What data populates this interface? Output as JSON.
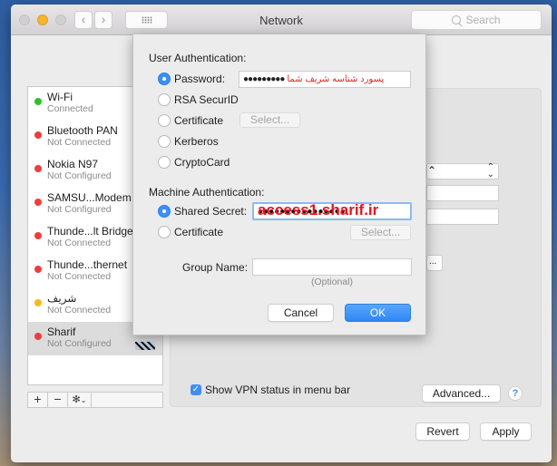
{
  "window": {
    "title": "Network",
    "search_placeholder": "Search",
    "nav_back": "‹",
    "nav_forward": "›"
  },
  "services": [
    {
      "name": "Wi-Fi",
      "status": "Connected",
      "color": "#2ec02e"
    },
    {
      "name": "Bluetooth PAN",
      "status": "Not Connected",
      "color": "#ef3d3d"
    },
    {
      "name": "Nokia N97",
      "status": "Not Configured",
      "color": "#ef3d3d"
    },
    {
      "name": "SAMSU...Modem",
      "status": "Not Configured",
      "color": "#ef3d3d"
    },
    {
      "name": "Thunde...lt Bridge",
      "status": "Not Connected",
      "color": "#ef3d3d"
    },
    {
      "name": "Thunde...thernet",
      "status": "Not Connected",
      "color": "#ef3d3d"
    },
    {
      "name": "شریف",
      "status": "Not Connected",
      "color": "#f6b82a"
    },
    {
      "name": "Sharif",
      "status": "Not Configured",
      "color": "#ef3d3d",
      "selected": true
    }
  ],
  "list_toolbar": {
    "add": "+",
    "remove": "−",
    "gear": "✻",
    "gear_caret": "⌄"
  },
  "panel": {
    "show_vpn_status_label": "Show VPN status in menu bar",
    "show_vpn_status_checked": true,
    "advanced_label": "Advanced...",
    "help_label": "?",
    "partial_button_label": "..."
  },
  "footer": {
    "revert_label": "Revert",
    "apply_label": "Apply"
  },
  "sheet": {
    "user_auth_label": "User Authentication:",
    "user_auth_options": [
      {
        "label": "Password:",
        "selected": true
      },
      {
        "label": "RSA SecurID",
        "selected": false
      },
      {
        "label": "Certificate",
        "selected": false
      },
      {
        "label": "Kerberos",
        "selected": false
      },
      {
        "label": "CryptoCard",
        "selected": false
      }
    ],
    "password_dots": "●●●●●●●●●",
    "password_annotation": "پسورد شناسه شریف شما",
    "user_cert_select_label": "Select...",
    "machine_auth_label": "Machine Authentication:",
    "machine_auth_options": [
      {
        "label": "Shared Secret:",
        "selected": true
      },
      {
        "label": "Certificate",
        "selected": false
      }
    ],
    "shared_secret_dots": "●●●●●●●●●●●●●●●●",
    "shared_secret_annotation": "access1.sharif.ir",
    "machine_cert_select_label": "Select...",
    "group_name_label": "Group Name:",
    "group_name_value": "",
    "group_name_hint": "(Optional)",
    "cancel_label": "Cancel",
    "ok_label": "OK"
  }
}
